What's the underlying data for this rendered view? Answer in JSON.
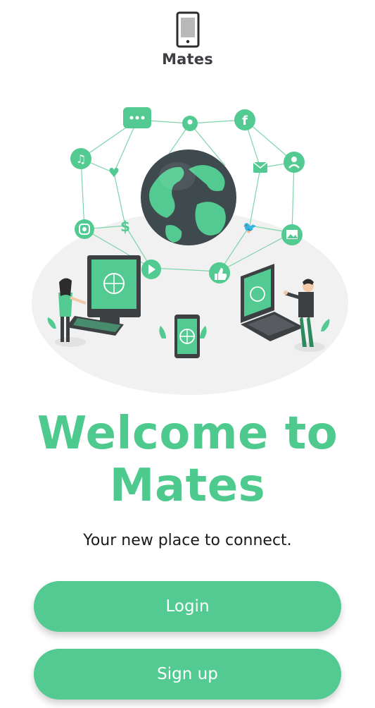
{
  "app": {
    "name": "Mates"
  },
  "welcome": {
    "title_line1": "Welcome to",
    "title_line2": "Mates",
    "subtitle": "Your new place to connect."
  },
  "buttons": {
    "login_label": "Login",
    "signup_label": "Sign up"
  },
  "colors": {
    "accent": "#52ca91",
    "title": "#4fca8f",
    "dark": "#3d3f42"
  },
  "illustration": {
    "icons": [
      "chat-icon",
      "location-icon",
      "facebook-icon",
      "music-icon",
      "heart-icon",
      "mail-icon",
      "user-icon",
      "dollar-icon",
      "twitter-icon",
      "instagram-icon",
      "image-icon",
      "play-icon",
      "like-icon",
      "globe-icon"
    ]
  }
}
